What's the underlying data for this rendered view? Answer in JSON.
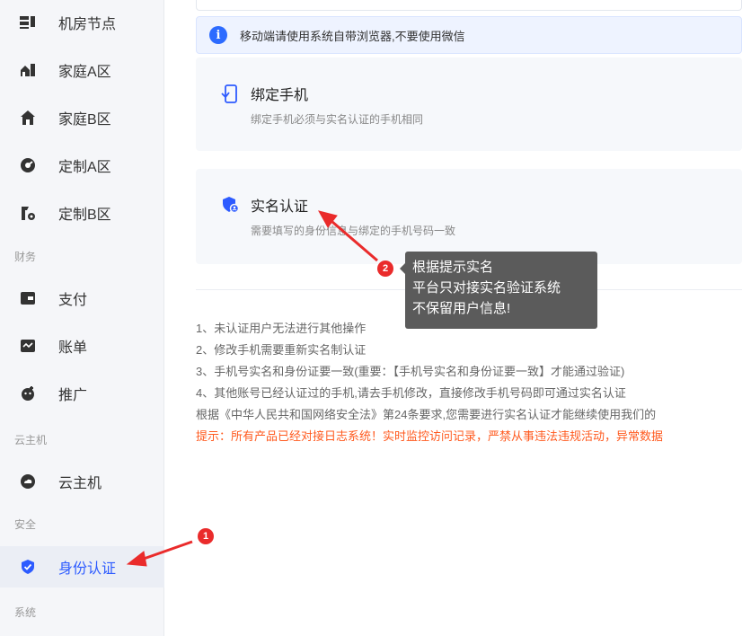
{
  "sidebar": {
    "items": [
      {
        "label": "机房节点",
        "icon": "server-rack-icon"
      },
      {
        "label": "家庭A区",
        "icon": "home-group-icon"
      },
      {
        "label": "家庭B区",
        "icon": "home-icon"
      },
      {
        "label": "定制A区",
        "icon": "gauge-icon"
      },
      {
        "label": "定制B区",
        "icon": "custom-tool-icon"
      }
    ],
    "section_finance": "财务",
    "finance_items": [
      {
        "label": "支付",
        "icon": "wallet-icon"
      },
      {
        "label": "账单",
        "icon": "bill-icon"
      },
      {
        "label": "推广",
        "icon": "promote-icon"
      }
    ],
    "section_cloud": "云主机",
    "cloud_items": [
      {
        "label": "云主机",
        "icon": "cloud-circle-icon"
      }
    ],
    "section_security": "安全",
    "security_items": [
      {
        "label": "身份认证",
        "icon": "shield-check-icon",
        "active": true
      }
    ],
    "section_system": "系统"
  },
  "notice": {
    "text": "移动端请使用系统自带浏览器,不要使用微信"
  },
  "cards": {
    "bind_phone": {
      "title": "绑定手机",
      "desc": "绑定手机必须与实名认证的手机相同"
    },
    "real_name": {
      "title": "实名认证",
      "desc": "需要填写的身份信息与绑定的手机号码一致"
    }
  },
  "notes": [
    "1、未认证用户无法进行其他操作",
    "2、修改手机需要重新实名制认证",
    "3、手机号实名和身份证要一致(重要：【手机号实名和身份证要一致】才能通过验证)",
    "4、其他账号已经认证过的手机,请去手机修改，直接修改手机号码即可通过实名认证",
    "根据《中华人民共和国网络安全法》第24条要求,您需要进行实名认证才能继续使用我们的"
  ],
  "warning": "提示：所有产品已经对接日志系统！实时监控访问记录，严禁从事违法违规活动，异常数据",
  "annotations": {
    "badge1": "1",
    "badge2": "2",
    "tooltip_lines": [
      "根据提示实名",
      "平台只对接实名验证系统",
      "不保留用户信息!"
    ]
  },
  "colors": {
    "accent": "#2d5bff",
    "warning": "#ff5a1f",
    "annotation_red": "#ea2b2b",
    "tooltip_bg": "#5b5b5b"
  }
}
